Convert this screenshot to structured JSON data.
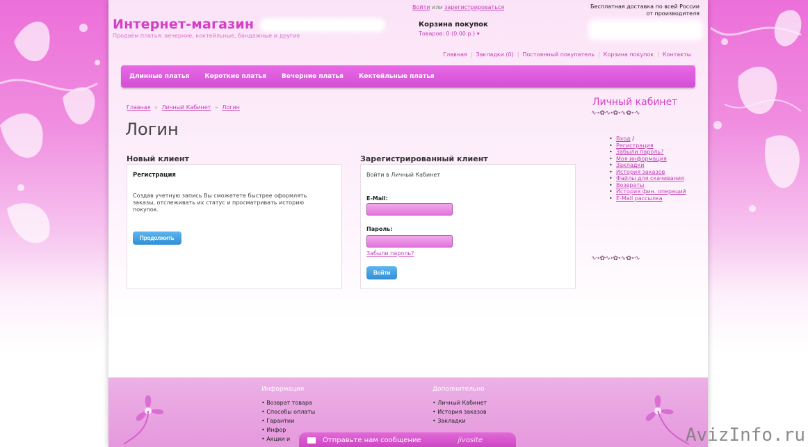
{
  "header": {
    "logo_text": "Интернет-магазин",
    "tagline": "Продаём платья: вечерние, коктейльные, бандажные и другие",
    "auth_login": "Войти",
    "auth_or": "или",
    "auth_register": "зарегистрироваться",
    "cart_title": "Корзина покупок",
    "cart_count": "Товаров: 0 (0.00 р.) ▾",
    "delivery": "Бесплатная доставка по всей России от производителя",
    "top_links": [
      "Главная",
      "Закладки (0)",
      "Постоянный покупатель",
      "Корзина покупок",
      "Контакты"
    ]
  },
  "nav": {
    "items": [
      "Длинные платья",
      "Короткие платья",
      "Вечерние платья",
      "Коктейльные платья"
    ]
  },
  "breadcrumb": [
    "Главная",
    "Личный Кабинет",
    "Логин"
  ],
  "main": {
    "title": "Логин",
    "new_client": {
      "heading": "Новый клиент",
      "subheading": "Регистрация",
      "text": "Создав учетную запись Вы сможетете быстрее оформлять заказы, отслеживать их статус и просматривать историю покупок.",
      "button": "Продолжить"
    },
    "registered_client": {
      "heading": "Зарегистрированный клиент",
      "intro": "Войти в Личный Кабинет",
      "email_label": "E-Mail:",
      "password_label": "Пароль:",
      "forgot": "Забыли пароль?",
      "button": "Войти"
    }
  },
  "sidebar": {
    "title": "Личный кабинет",
    "items": [
      {
        "label": "Вход",
        "suffix": " /"
      },
      {
        "label": "Регистрация",
        "suffix": ""
      },
      {
        "label": "Забыли пароль?",
        "suffix": ""
      },
      {
        "label": "Моя информация",
        "suffix": ""
      },
      {
        "label": "Закладки",
        "suffix": ""
      },
      {
        "label": "История заказов",
        "suffix": ""
      },
      {
        "label": "Файлы для скачивания",
        "suffix": ""
      },
      {
        "label": "Возвраты",
        "suffix": ""
      },
      {
        "label": "История фин. операций",
        "suffix": ""
      },
      {
        "label": "E-Mail рассылка",
        "suffix": ""
      }
    ]
  },
  "footer": {
    "info_title": "Информация",
    "info_items": [
      "Возврат товара",
      "Способы оплаты",
      "Гарантии",
      "Инфор",
      "Акции и"
    ],
    "extra_title": "Дополнительно",
    "extra_items": [
      "Личный Кабинет",
      "История заказов",
      "Закладки"
    ]
  },
  "chat": {
    "label": "Отправьте нам сообщение",
    "brand": "jivosite"
  },
  "watermark": "AvizInfo.ru",
  "colors": {
    "accent": "#d43fc6",
    "nav_bg": "#e060de",
    "button_blue": "#2f8fd6"
  }
}
